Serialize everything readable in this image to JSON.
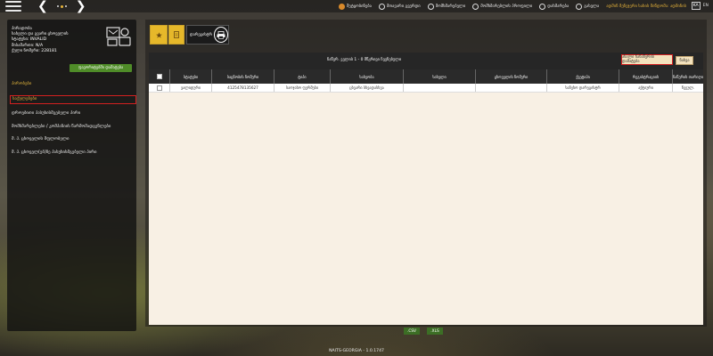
{
  "topbar": {
    "menu": [
      {
        "label": "შეტყობინება",
        "icon": "bell-icon"
      },
      {
        "label": "მთავარი გვერდი",
        "icon": "home-icon"
      },
      {
        "label": "მომხმარებელი",
        "icon": "user-icon"
      },
      {
        "label": "მომხმარებლის პროფილი",
        "icon": "profile-icon"
      },
      {
        "label": "დახმარება",
        "icon": "help-icon"
      },
      {
        "label": "გასვლა",
        "icon": "logout-icon"
      }
    ],
    "user_name": "ადმინ მენეჯერი სახის მიწდომა: ადმინის",
    "lang_ka": "KA",
    "lang_en": "EN"
  },
  "left_panel": {
    "info": [
      "პირადობა",
      "სახელი და გვარი ცხოველის",
      "სტატუსი: INVALID",
      "მისამართი: N/A",
      "ქული ნომერი: 228181"
    ],
    "favorite_button": "ფავორიტებში დამატება",
    "menu": [
      {
        "label": "პირობები",
        "style": "normal"
      },
      {
        "label": "საქულებები",
        "style": "selected"
      },
      {
        "label": "დროებითი პასუხისმგებელი პირი",
        "style": "normal"
      },
      {
        "label": "მომხმარებლები / კომპანიის წარმომადგენლები",
        "style": "normal"
      },
      {
        "label": "მ. პ. ცხოველის მფლობელი",
        "style": "normal"
      },
      {
        "label": "მ. პ. ცხოველ(ებ)ზე პასუხისმგებელი პირი",
        "style": "normal"
      }
    ]
  },
  "tiles": {
    "tile3_label": "დარეგისტრ"
  },
  "grid": {
    "title": "ჩაწერ. ველის 1 - 0 მწკრივი ჩვენებული",
    "enter_button": "ახალი ჩანაწერის დამატება",
    "view_button": "ნახვა",
    "columns": [
      "",
      "სტატუსი",
      "საცნობის ნომერი",
      "ტიპი",
      "სახეობა",
      "სახელი",
      "ცხოველის ნომერი",
      "ქვეტიპი",
      "რეგისტრაციის",
      "ჩაწერის თარიღი"
    ],
    "rows": [
      [
        "",
        "ვალიდური",
        "4125478135627",
        "საოჯახო ფერმები",
        "ცხვარი სხვადასხვა",
        "",
        "",
        "საჩეხო დარეგისტრ",
        "აქტიური",
        "ჩვეულ."
      ]
    ]
  },
  "footer": {
    "csv": ".CSV",
    "xls": ".XLS",
    "version": "NAITS-GEORGIA - 1.0.1747"
  }
}
